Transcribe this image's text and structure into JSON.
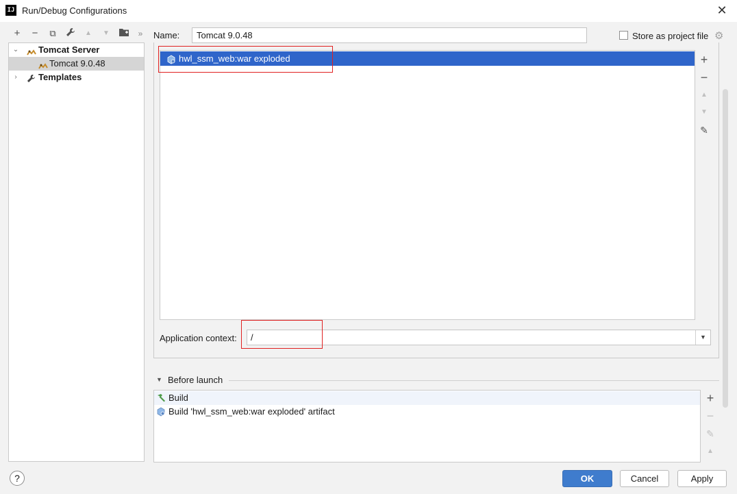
{
  "window": {
    "title": "Run/Debug Configurations",
    "app_logo": "IJ"
  },
  "toolbar": {
    "add_icon": "+",
    "remove_icon": "−",
    "copy_icon": "⧉",
    "wrench_icon": "🔧",
    "up_icon": "▲",
    "down_icon": "▼",
    "folder_icon": "📁",
    "more_icon": "»"
  },
  "tree": {
    "items": [
      {
        "label": "Tomcat Server",
        "bold": true,
        "expanded": true
      },
      {
        "label": "Tomcat 9.0.48",
        "selected": true
      },
      {
        "label": "Templates",
        "bold": true,
        "expanded": false
      }
    ]
  },
  "name_field": {
    "label": "Name:",
    "value": "Tomcat 9.0.48"
  },
  "store_as_project_file": {
    "label": "Store as project file",
    "checked": false
  },
  "deployment": {
    "artifacts": [
      "hwl_ssm_web:war exploded"
    ],
    "side_buttons": {
      "add": "+",
      "remove": "−",
      "up": "▲",
      "down": "▼",
      "edit": "✎"
    }
  },
  "application_context": {
    "label": "Application context:",
    "value": "/",
    "dropdown_icon": "▼"
  },
  "before_launch": {
    "header": "Before launch",
    "collapse_icon": "▼",
    "items": [
      "Build",
      "Build 'hwl_ssm_web:war exploded' artifact"
    ],
    "side_buttons": {
      "add": "+",
      "remove": "−",
      "edit": "✎",
      "up": "▲"
    }
  },
  "buttons": {
    "help": "?",
    "ok": "OK",
    "cancel": "Cancel",
    "apply": "Apply"
  },
  "colors": {
    "accent": "#3f7ccd",
    "selection": "#2f65ca",
    "annotation": "#e02020"
  }
}
